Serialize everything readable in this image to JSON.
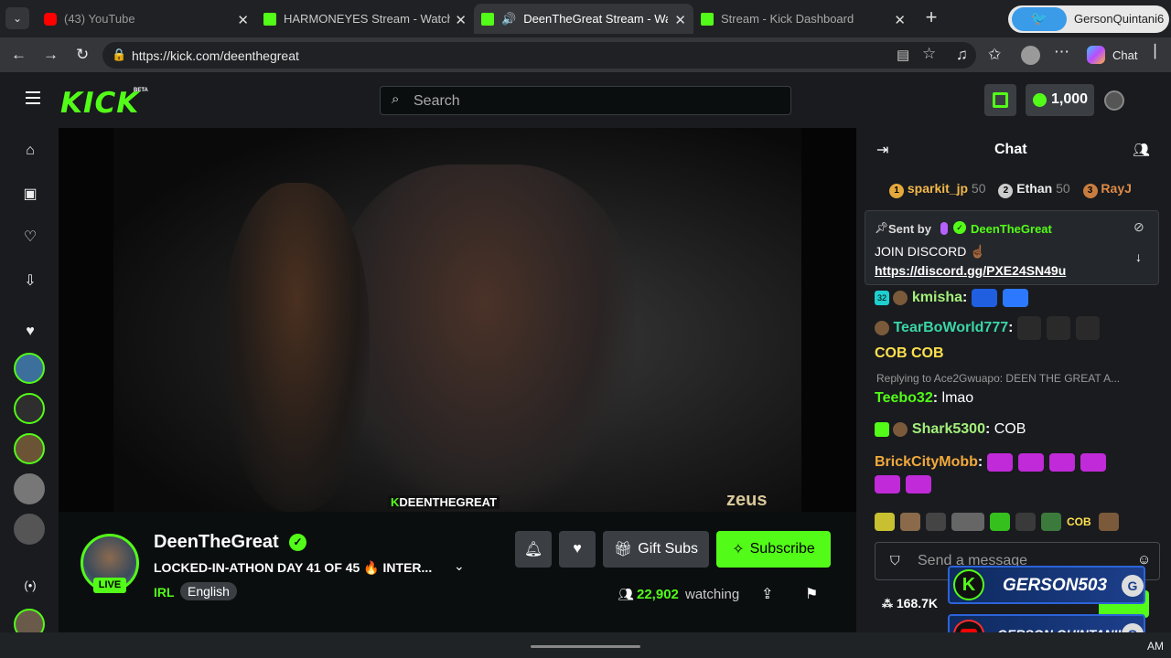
{
  "browser": {
    "tabs": [
      {
        "title": "(43) YouTube",
        "favicon_color": "#ff0000"
      },
      {
        "title": "HARMONEYES Stream - Watch Live",
        "favicon_color": "#53fc18"
      },
      {
        "title": "DeenTheGreat Stream - Watch",
        "favicon_color": "#53fc18"
      },
      {
        "title": "Stream - Kick Dashboard",
        "favicon_color": "#53fc18"
      }
    ],
    "profile_name": "GersonQuintani6",
    "url": "https://kick.com/deenthegreat",
    "chat_button": "Chat"
  },
  "kick": {
    "logo": "KICK",
    "beta": "BETA",
    "search_placeholder": "Search",
    "points": "1,000",
    "accent": "#53fc18"
  },
  "stream": {
    "watermark": "DEENTHEGREAT",
    "sponsor": "zeus",
    "channel_name": "DeenTheGreat",
    "live_badge": "LIVE",
    "title": "LOCKED-IN-ATHON DAY 41 OF 45 🔥 INTER...",
    "category": "IRL",
    "language": "English",
    "gift_subs": "Gift Subs",
    "subscribe": "Subscribe",
    "viewers": "22,902",
    "viewers_label": "watching",
    "followers": "168.7K"
  },
  "chat": {
    "header": "Chat",
    "leaderboard": [
      {
        "rank": "1",
        "name": "sparkit_jp",
        "score": "50"
      },
      {
        "rank": "2",
        "name": "Ethan",
        "score": "50"
      },
      {
        "rank": "3",
        "name": "RayJ",
        "score": ""
      }
    ],
    "pinned": {
      "sent_by": "Sent by",
      "author": "DeenTheGreat",
      "text": "JOIN DISCORD ☝🏾",
      "link": "https://discord.gg/PXE24SN49u"
    },
    "messages": [
      {
        "badge": "32",
        "user": "kmisha",
        "text": ""
      },
      {
        "user": "TearBoWorld777",
        "text": "COB COB"
      },
      {
        "reply": "Replying to Ace2Gwuapo: DEEN THE GREAT A...",
        "user": "Teebo32",
        "text": "lmao"
      },
      {
        "user": "Shark5300",
        "text": "COB"
      },
      {
        "user": "BrickCityMobb",
        "text": ""
      }
    ],
    "emote_row_cob": "COB",
    "input_placeholder": "Send a message"
  },
  "overlay": {
    "kick_name": "GERSON503",
    "youtube_name": "GERSON QUINTANILLA"
  },
  "taskbar": {
    "clock": "AM"
  }
}
